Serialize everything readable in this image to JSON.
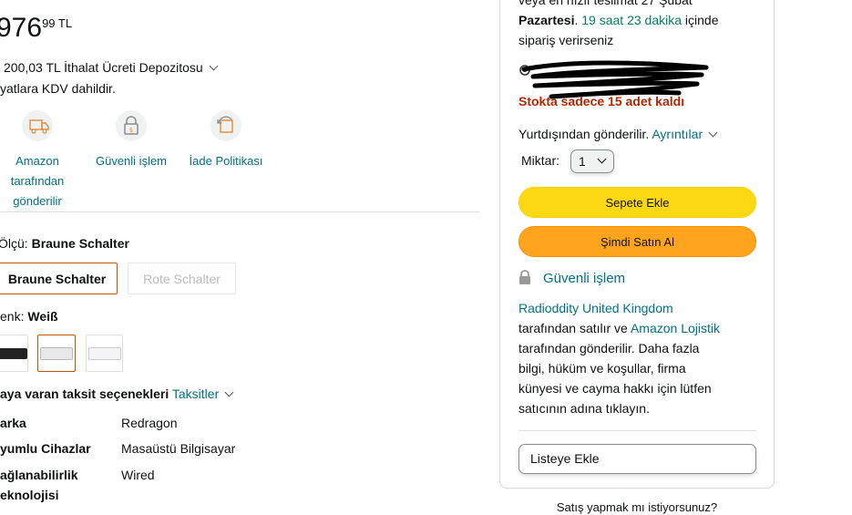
{
  "price": {
    "whole": "976",
    "fraction": "99",
    "currency": "TL"
  },
  "import_fee": "200,03 TL İthalat Ücreti Depozitosu",
  "vat_note": "yatlara KDV dahildir.",
  "features": [
    {
      "label_lines": [
        "Amazon",
        "tarafından",
        "gönderilir"
      ],
      "icon": "truck-icon"
    },
    {
      "label_lines": [
        "Güvenli işlem"
      ],
      "icon": "lock-icon"
    },
    {
      "label_lines": [
        "İade Politikası"
      ],
      "icon": "return-icon"
    }
  ],
  "size": {
    "label": "Ölçü:",
    "selected": "Braune Schalter",
    "options": [
      "Braune Schalter",
      "Rote Schalter"
    ]
  },
  "color": {
    "label": "enk:",
    "selected": "Weiß"
  },
  "installment": {
    "text": "aya varan taksit seçenekleri",
    "link": "Taksitler"
  },
  "specs": [
    {
      "key": "Marka",
      "key_shown": "arka",
      "value": "Redragon"
    },
    {
      "key": "Uyumlu Cihazlar",
      "key_shown": "yumlu Cihazlar",
      "value": "Masaüstü Bilgisayar"
    },
    {
      "key_shown": "ağlanabilirlik",
      "key_shown_2": "eknolojisi",
      "value": "Wired"
    }
  ],
  "buybox": {
    "delivery_top": "veya en hızlı teslimat 27 Şubat",
    "delivery_day": "Pazartesi",
    "delivery_timer": "19 saat 23 dakika",
    "delivery_in": "içinde",
    "delivery_order": "sipariş verirseniz",
    "stock": "Stokta sadece 15 adet kaldı",
    "ships_from": "Yurtdışından gönderilir.",
    "details_link": "Ayrıntılar",
    "qty_label": "Miktar:",
    "qty_value": "1",
    "add_to_cart": "Sepete Ekle",
    "buy_now": "Şimdi Satın Al",
    "secure": "Güvenli işlem",
    "seller": "Radioddity United Kingdom",
    "sold_by": "tarafından satılır ve",
    "fulfilled": "Amazon Lojistik",
    "desc": [
      "tarafından gönderilir. Daha fazla",
      "bilgi, hüküm ve koşullar, firma",
      "künyesi ve cayma hakkı için lütfen",
      "satıcının adına tıklayın."
    ],
    "add_to_list": "Listeye Ekle"
  },
  "sell_prompt": "Satış yapmak mı istiyorsunuz?",
  "colors": {
    "accent_link": "#007185",
    "stock_red": "#b12704",
    "timer_green": "#067d62",
    "cart_yellow": "#ffd814",
    "buy_orange": "#ffa41c"
  }
}
